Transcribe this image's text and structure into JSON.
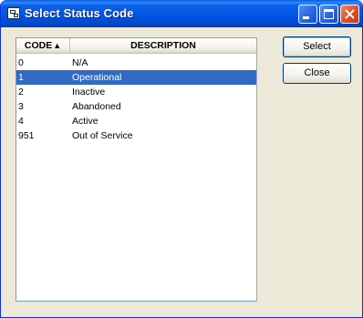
{
  "window": {
    "title": "Select Status Code"
  },
  "titlebar_buttons": {
    "minimize": "minimize",
    "maximize": "maximize",
    "close": "close"
  },
  "listview": {
    "columns": [
      {
        "label": "CODE",
        "sort": "ascending"
      },
      {
        "label": "DESCRIPTION"
      }
    ],
    "sort_indicator": "▲",
    "rows": [
      {
        "code": "0",
        "description": "N/A",
        "selected": false
      },
      {
        "code": "1",
        "description": "Operational",
        "selected": true
      },
      {
        "code": "2",
        "description": "Inactive",
        "selected": false
      },
      {
        "code": "3",
        "description": "Abandoned",
        "selected": false
      },
      {
        "code": "4",
        "description": "Active",
        "selected": false
      },
      {
        "code": "951",
        "description": "Out of Service",
        "selected": false
      }
    ]
  },
  "buttons": {
    "select": "Select",
    "close": "Close"
  },
  "colors": {
    "titlebar": "#0054e3",
    "selection": "#316ac5",
    "window_bg": "#ece9d8"
  }
}
